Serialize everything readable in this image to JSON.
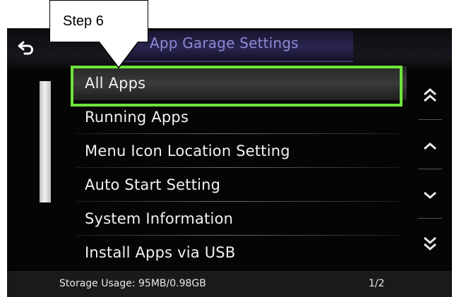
{
  "callout": {
    "text": "Step 6"
  },
  "header": {
    "title": "App Garage Settings",
    "back_icon": "back-arrow-icon"
  },
  "menu": {
    "items": [
      {
        "label": "All Apps",
        "selected": true
      },
      {
        "label": "Running Apps"
      },
      {
        "label": "Menu Icon Location Setting"
      },
      {
        "label": "Auto Start Setting"
      },
      {
        "label": "System Information"
      },
      {
        "label": "Install Apps via USB"
      }
    ]
  },
  "arrows": {
    "page_up": "double-chevron-up-icon",
    "up": "chevron-up-icon",
    "down": "chevron-down-icon",
    "page_down": "double-chevron-down-icon"
  },
  "footer": {
    "storage": "Storage Usage: 95MB/0.98GB",
    "page": "1/2"
  },
  "colors": {
    "highlight": "#6fe43a",
    "title": "#8c8cd6"
  }
}
